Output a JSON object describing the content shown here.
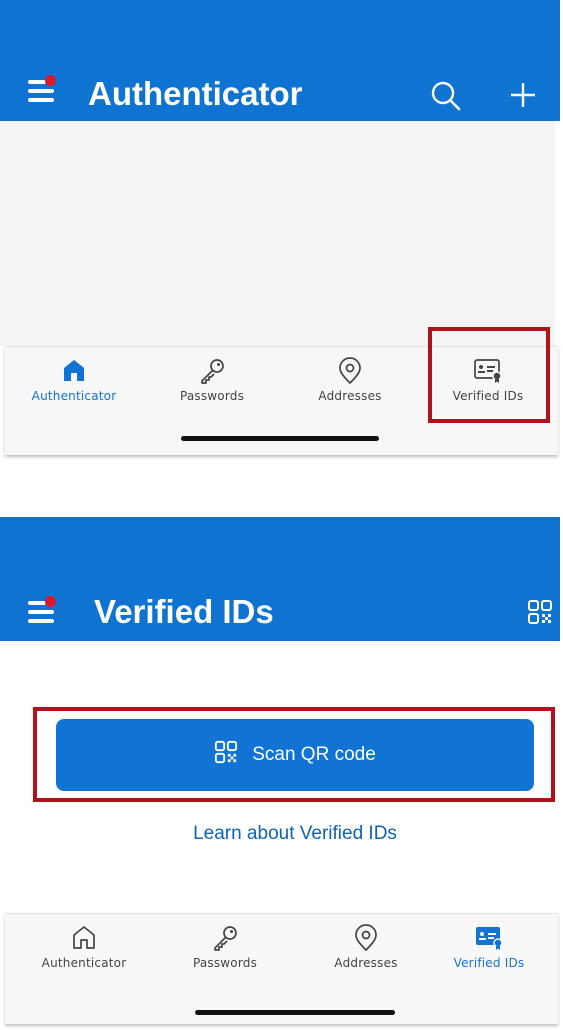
{
  "top": {
    "app_title": "Authenticator",
    "actions": {
      "search_icon": "search-icon",
      "add_icon": "plus-icon"
    },
    "tabs": [
      {
        "label": "Authenticator",
        "icon": "home-icon",
        "active": true
      },
      {
        "label": "Passwords",
        "icon": "key-icon",
        "active": false
      },
      {
        "label": "Addresses",
        "icon": "location-pin-icon",
        "active": false
      },
      {
        "label": "Verified IDs",
        "icon": "id-card-icon",
        "active": false
      }
    ]
  },
  "bottom": {
    "app_title": "Verified IDs",
    "actions": {
      "qr_icon": "qr-code-icon"
    },
    "scan_button_label": "Scan QR code",
    "learn_link": "Learn about Verified IDs",
    "tabs": [
      {
        "label": "Authenticator",
        "icon": "home-outline-icon",
        "active": false
      },
      {
        "label": "Passwords",
        "icon": "key-icon",
        "active": false
      },
      {
        "label": "Addresses",
        "icon": "location-pin-icon",
        "active": false
      },
      {
        "label": "Verified IDs",
        "icon": "id-card-icon",
        "active": true
      }
    ]
  },
  "colors": {
    "brand_blue": "#0f73d1",
    "button_blue": "#1173d3",
    "link_blue": "#0f63b5",
    "highlight_red": "#b0121b",
    "notification_red": "#e0162b"
  }
}
